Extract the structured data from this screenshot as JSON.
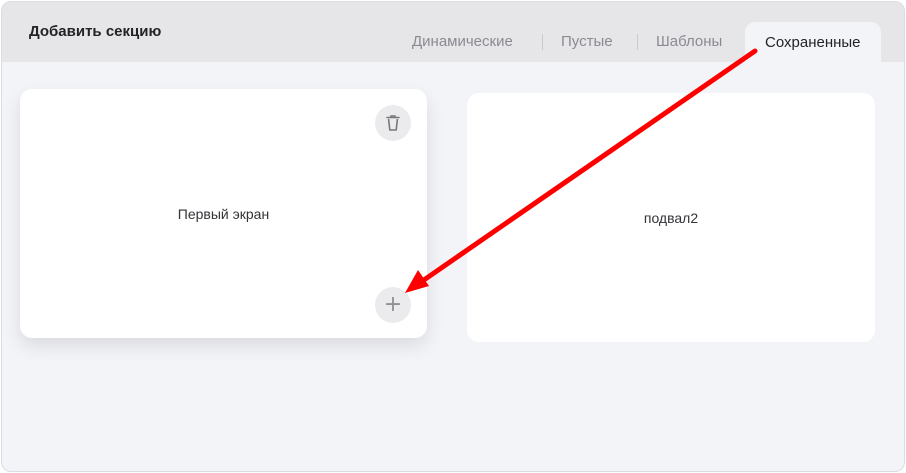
{
  "header": {
    "title": "Добавить секцию"
  },
  "tabs": [
    {
      "label": "Динамические",
      "active": false
    },
    {
      "label": "Пустые",
      "active": false
    },
    {
      "label": "Шаблоны",
      "active": false
    },
    {
      "label": "Сохраненные",
      "active": true
    }
  ],
  "cards": [
    {
      "label": "Первый экран",
      "delete_icon": "trash-icon",
      "add_icon": "plus-icon"
    },
    {
      "label": "подвал2"
    }
  ],
  "colors": {
    "annotation_arrow": "#ff0000",
    "panel_bg": "#f3f4f8",
    "header_bg": "#e6e6e8"
  }
}
